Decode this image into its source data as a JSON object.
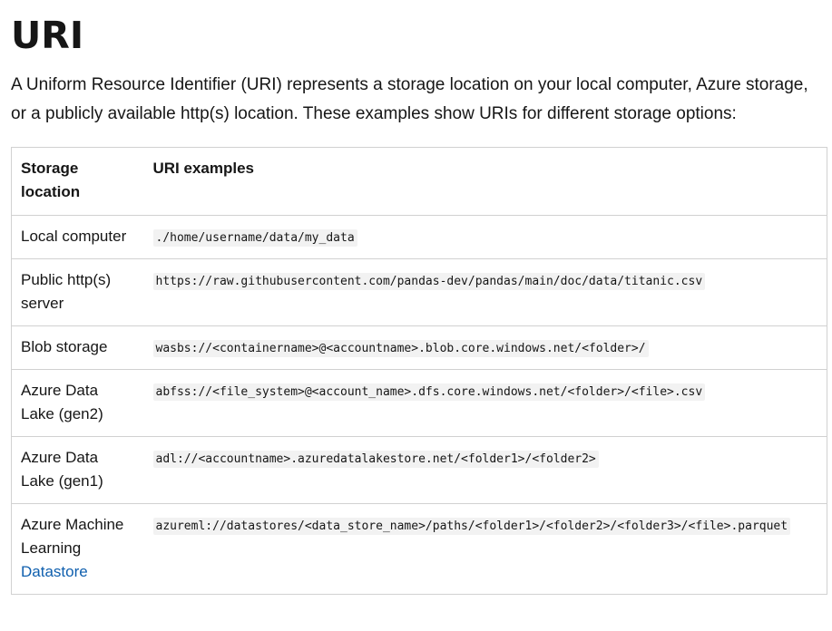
{
  "heading": "URI",
  "intro": "A Uniform Resource Identifier (URI) represents a storage location on your local computer, Azure storage, or a publicly available http(s) location. These examples show URIs for different storage options:",
  "table": {
    "headers": [
      "Storage location",
      "URI examples"
    ],
    "rows": [
      {
        "location": "Local computer",
        "uri": "./home/username/data/my_data"
      },
      {
        "location": "Public http(s) server",
        "uri": "https://raw.githubusercontent.com/pandas-dev/pandas/main/doc/data/titanic.csv"
      },
      {
        "location": "Blob storage",
        "uri": "wasbs://<containername>@<accountname>.blob.core.windows.net/<folder>/"
      },
      {
        "location": "Azure Data Lake (gen2)",
        "uri": "abfss://<file_system>@<account_name>.dfs.core.windows.net/<folder>/<file>.csv"
      },
      {
        "location": "Azure Data Lake (gen1)",
        "uri": "adl://<accountname>.azuredatalakestore.net/<folder1>/<folder2>"
      },
      {
        "location": "Azure Machine Learning",
        "location_link": "Datastore",
        "uri": "azureml://datastores/<data_store_name>/paths/<folder1>/<folder2>/<folder3>/<file>.parquet"
      }
    ]
  }
}
